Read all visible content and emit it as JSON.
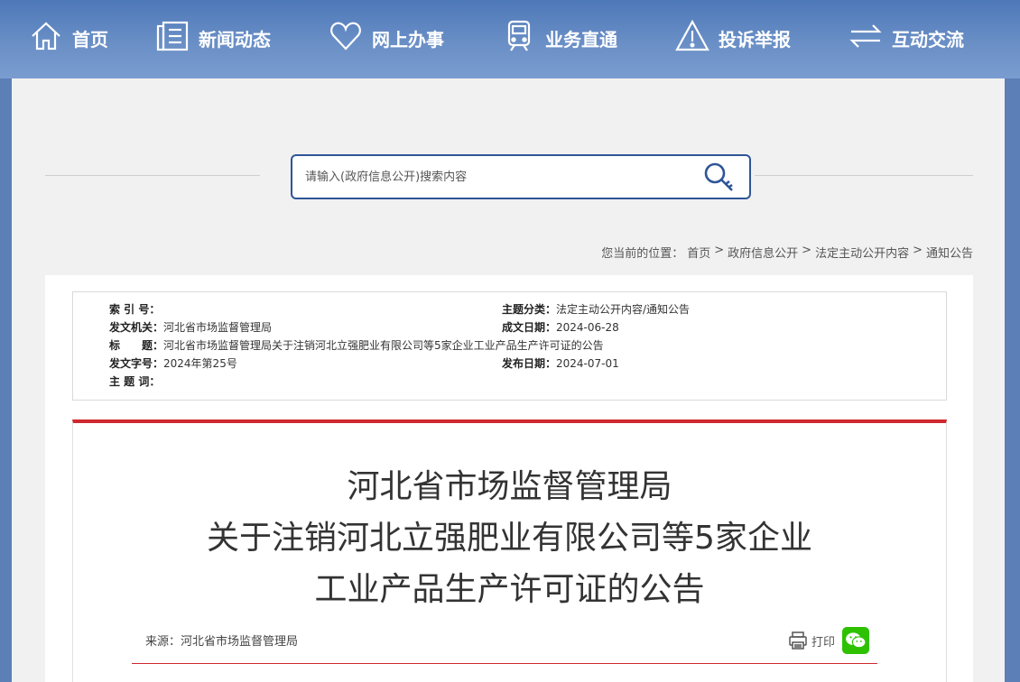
{
  "nav": [
    {
      "label": "首页",
      "icon": "home-icon"
    },
    {
      "label": "新闻动态",
      "icon": "news-icon"
    },
    {
      "label": "网上办事",
      "icon": "heart-icon"
    },
    {
      "label": "业务直通",
      "icon": "train-icon"
    },
    {
      "label": "投诉举报",
      "icon": "warning-icon"
    },
    {
      "label": "互动交流",
      "icon": "exchange-icon"
    }
  ],
  "search": {
    "placeholder": "请输入(政府信息公开)搜索内容"
  },
  "breadcrumb": {
    "prefix": "您当前的位置：",
    "items": [
      "首页",
      "政府信息公开",
      "法定主动公开内容",
      "通知公告"
    ],
    "separator": ">"
  },
  "meta": {
    "index_label": "索 引 号：",
    "index_value": "",
    "topic_label": "主题分类：",
    "topic_value": "法定主动公开内容/通知公告",
    "issuer_label": "发文机关：",
    "issuer_value": "河北省市场监督管理局",
    "created_label": "成文日期：",
    "created_value": "2024-06-28",
    "title_label": "标　　题：",
    "title_value": "河北省市场监督管理局关于注销河北立强肥业有限公司等5家企业工业产品生产许可证的公告",
    "docno_label": "发文字号：",
    "docno_value": "2024年第25号",
    "published_label": "发布日期：",
    "published_value": "2024-07-01",
    "keywords_label": "主 题 词：",
    "keywords_value": ""
  },
  "article": {
    "title_lines": [
      "河北省市场监督管理局",
      "关于注销河北立强肥业有限公司等5家企业",
      "工业产品生产许可证的公告"
    ],
    "source": "来源：河北省市场监督管理局",
    "print_label": "打印"
  },
  "colors": {
    "nav_bg": "#5b7fb6",
    "accent_red": "#d0282f",
    "search_border": "#2e5597",
    "wechat_green": "#2dc100"
  }
}
